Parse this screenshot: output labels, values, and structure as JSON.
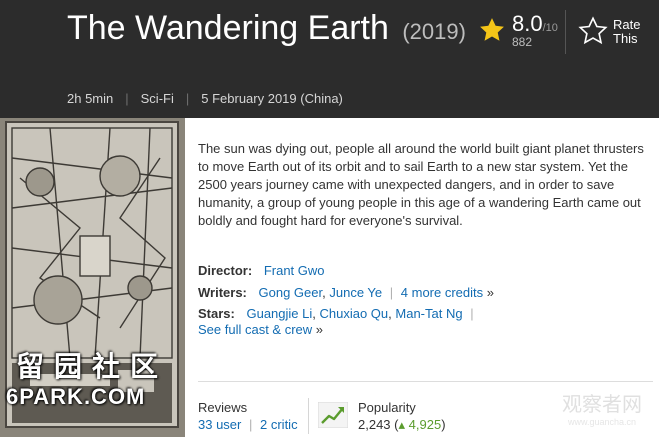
{
  "header": {
    "title": "The Wandering Earth",
    "year": "(2019)",
    "runtime": "2h 5min",
    "genre": "Sci-Fi",
    "release": "5 February 2019 (China)",
    "rating": {
      "value": "8.0",
      "best": "/10",
      "count": "882"
    },
    "rate_this": "Rate This",
    "colors": {
      "background": "#2c2c2c",
      "star": "#f5c518"
    }
  },
  "poster": {
    "watermark_cn": "留园社区",
    "watermark_site": "6PARK.COM",
    "icon": "movie-poster"
  },
  "summary": "The sun was dying out, people all around the world built giant planet thrusters to move Earth out of its orbit and to sail Earth to a new star system. Yet the 2500 years journey came with unexpected dangers, and in order to save humanity, a group of young people in this age of a wandering Earth came out boldly and fought hard for everyone's survival.",
  "credits": {
    "director_label": "Director:",
    "directors": [
      "Frant Gwo"
    ],
    "writers_label": "Writers:",
    "writers": [
      "Gong Geer",
      "Junce Ye"
    ],
    "more_credits": "4 more credits",
    "stars_label": "Stars:",
    "stars": [
      "Guangjie Li",
      "Chuxiao Qu",
      "Man-Tat Ng"
    ],
    "full_cast": "See full cast & crew"
  },
  "reviews": {
    "label": "Reviews",
    "user": "33 user",
    "critic": "2 critic"
  },
  "popularity": {
    "label": "Popularity",
    "rank": "2,243",
    "delta": "4,925",
    "icon": "trend-up-icon"
  },
  "watermark_corner": {
    "text": "观察者网",
    "url": "www.guancha.cn"
  }
}
